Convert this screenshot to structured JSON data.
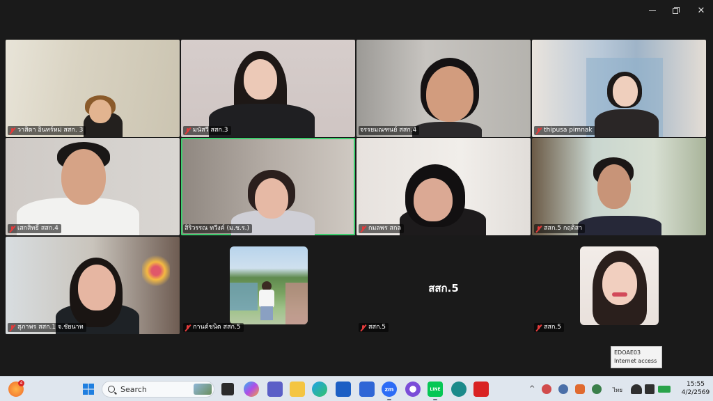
{
  "window": {
    "controls": {
      "minimize": "minimize",
      "maximize": "restore",
      "close": "close"
    }
  },
  "participants": [
    {
      "name": "วาสิตา อินทร์หม่ สสก. 3",
      "muted": true
    },
    {
      "name": "มนัสวี สสก.3",
      "muted": true
    },
    {
      "name": "จรรยมณฑนย์ สสก.4",
      "muted": false
    },
    {
      "name": "thipusa pimnak",
      "muted": true
    },
    {
      "name": "เสกสิทธิ์ สสก.4",
      "muted": true
    },
    {
      "name": "สิริวรรณ ทวีงค์ (ม.ช.ร.)",
      "muted": false,
      "active_speaker": true
    },
    {
      "name": "กมลพร สกล",
      "muted": true
    },
    {
      "name": "สสก.5 กฤติสา",
      "muted": true
    },
    {
      "name": "สุภาพร สสก.1 จ.ชัยนาท",
      "muted": true
    },
    {
      "name": "กานต์ชนิต สสก.5",
      "muted": true
    },
    {
      "name": "สสก.5",
      "muted": true,
      "center_label": "สสก.5"
    },
    {
      "name": "สสก.5",
      "muted": true
    }
  ],
  "tooltip": {
    "line1": "EDOAE03",
    "line2": "Internet access"
  },
  "taskbar": {
    "notification_badge": "4",
    "search_placeholder": "Search",
    "apps": [
      {
        "name": "zoom",
        "label": "zm",
        "color": "#2d6cf6"
      },
      {
        "name": "line",
        "label": "LINE",
        "color": "#06c755"
      }
    ],
    "language": "ไทย",
    "clock_time": "15:55",
    "clock_date": "4/2/2569"
  },
  "colors": {
    "active_speaker_border": "#3ecf6f",
    "muted_icon": "#e23b3b"
  }
}
